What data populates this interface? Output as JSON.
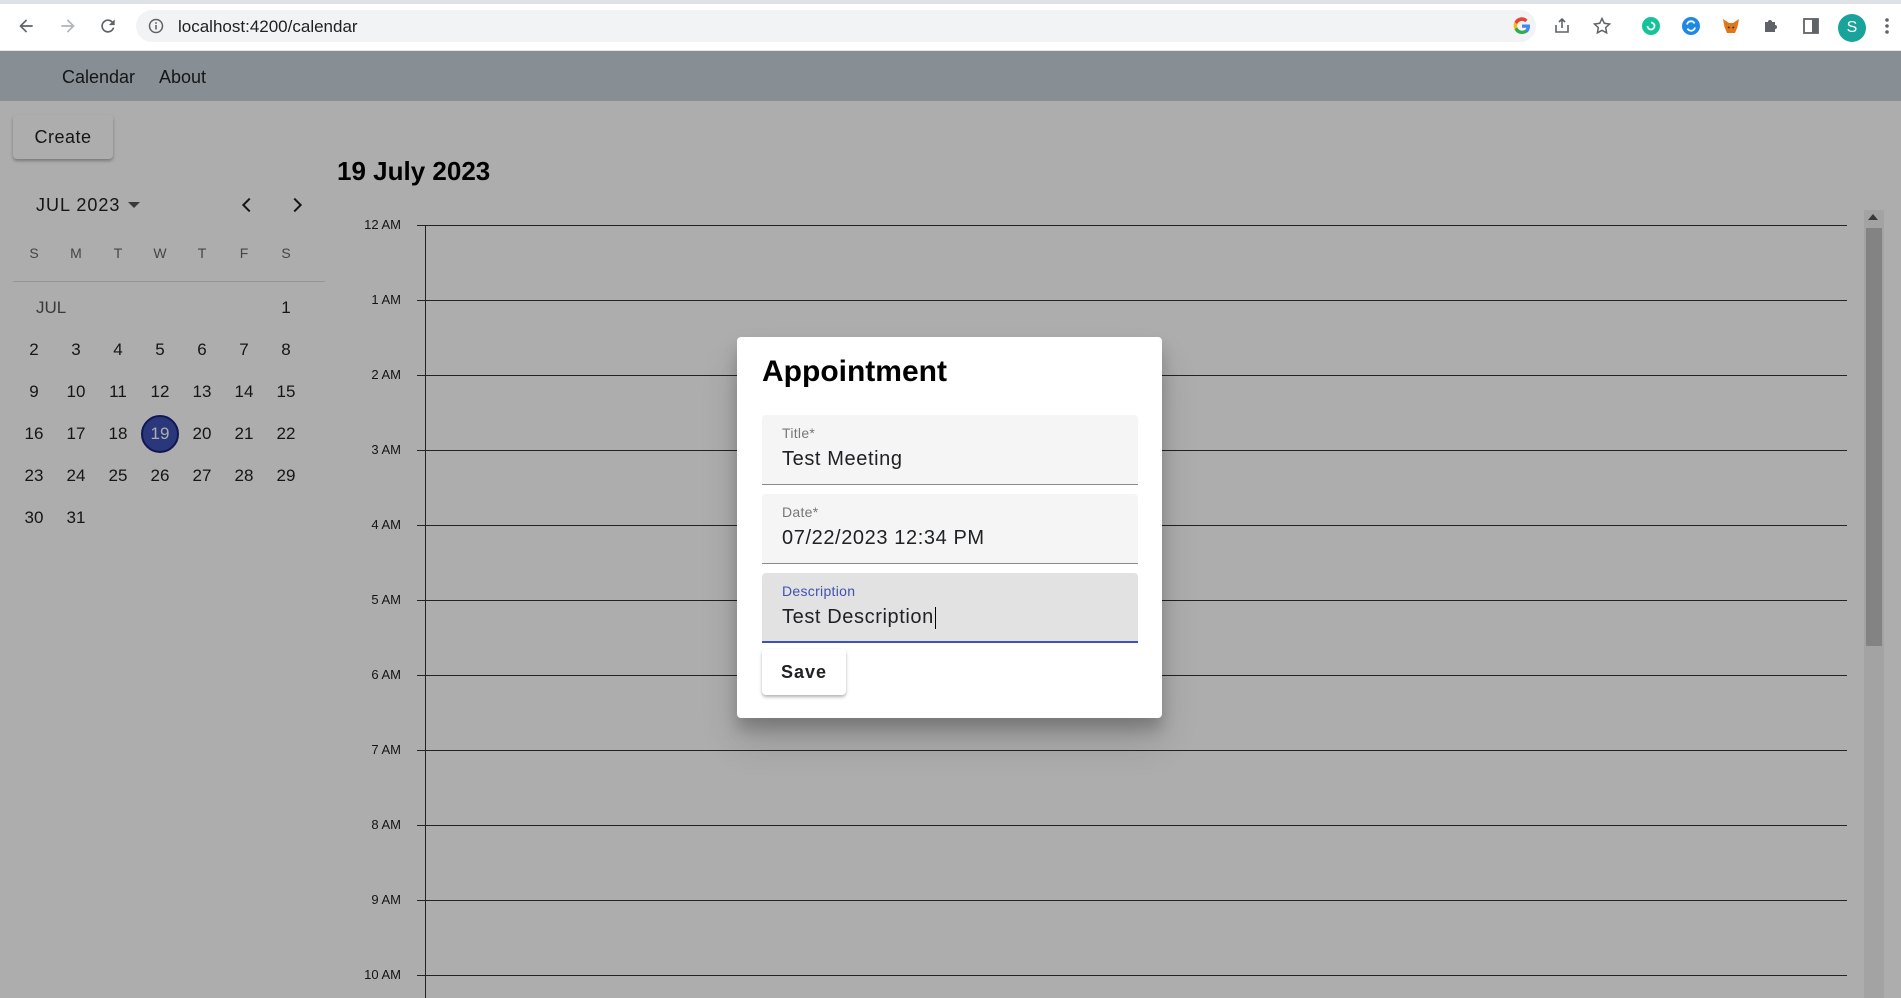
{
  "browser": {
    "url": "localhost:4200/calendar",
    "profile_initial": "S"
  },
  "topnav": {
    "items": [
      {
        "label": "Calendar"
      },
      {
        "label": "About"
      }
    ]
  },
  "sidebar": {
    "create_label": "Create",
    "month_label": "JUL 2023",
    "weekdays": [
      "S",
      "M",
      "T",
      "W",
      "T",
      "F",
      "S"
    ],
    "month_short": "JUL",
    "selected_day": 19,
    "weeks": [
      [
        "",
        "",
        "",
        "",
        "",
        "",
        "1"
      ],
      [
        "2",
        "3",
        "4",
        "5",
        "6",
        "7",
        "8"
      ],
      [
        "9",
        "10",
        "11",
        "12",
        "13",
        "14",
        "15"
      ],
      [
        "16",
        "17",
        "18",
        "19",
        "20",
        "21",
        "22"
      ],
      [
        "23",
        "24",
        "25",
        "26",
        "27",
        "28",
        "29"
      ],
      [
        "30",
        "31",
        "",
        "",
        "",
        "",
        ""
      ]
    ]
  },
  "main": {
    "day_title": "19 July 2023",
    "hours": [
      "12 AM",
      "1 AM",
      "2 AM",
      "3 AM",
      "4 AM",
      "5 AM",
      "6 AM",
      "7 AM",
      "8 AM",
      "9 AM",
      "10 AM"
    ]
  },
  "dialog": {
    "title": "Appointment",
    "fields": {
      "title": {
        "label": "Title*",
        "value": "Test Meeting"
      },
      "date": {
        "label": "Date*",
        "value": "07/22/2023 12:34 PM"
      },
      "description": {
        "label": "Description",
        "value": "Test Description"
      }
    },
    "save_label": "Save"
  },
  "colors": {
    "topnav_bg": "#c9d3db",
    "accent": "#3f51b5"
  }
}
